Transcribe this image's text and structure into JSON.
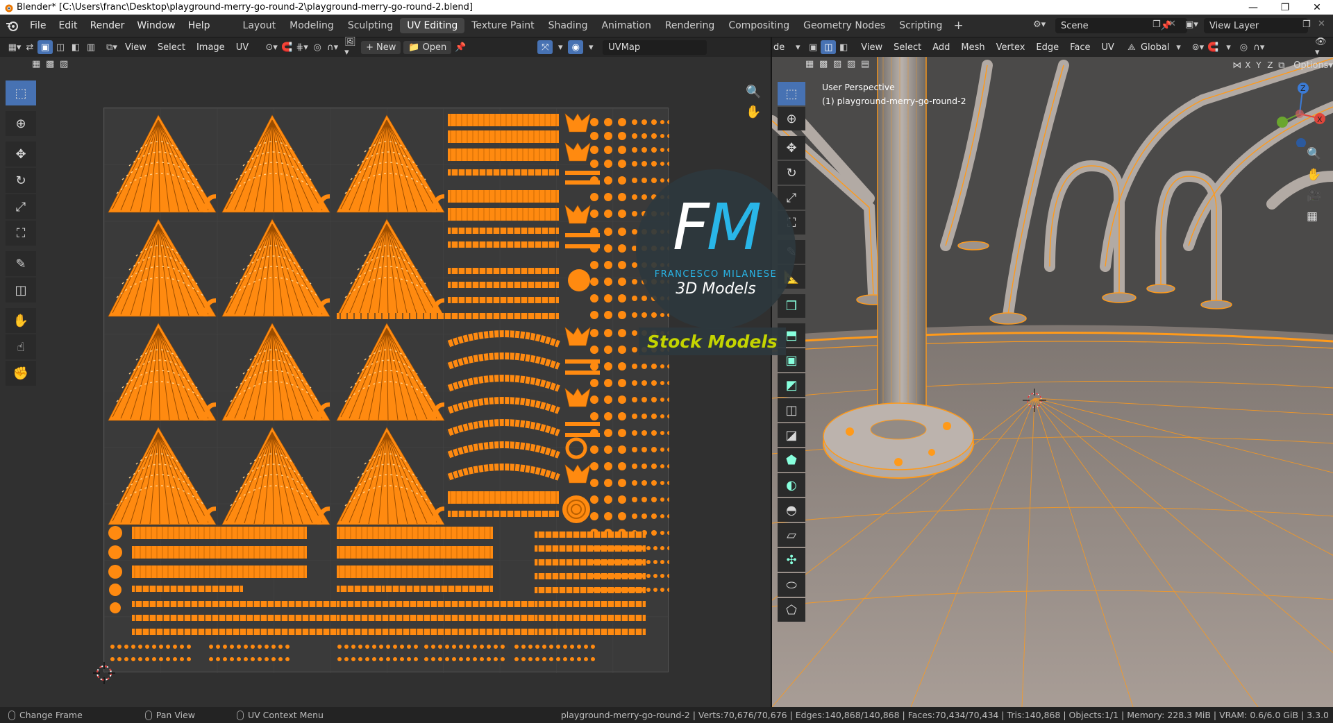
{
  "window": {
    "title": "Blender* [C:\\Users\\franc\\Desktop\\playground-merry-go-round-2\\playground-merry-go-round-2.blend]",
    "buttons": [
      "—",
      "❐",
      "✕"
    ]
  },
  "topbar": {
    "menu": [
      "File",
      "Edit",
      "Render",
      "Window",
      "Help"
    ],
    "workspaces": [
      "Layout",
      "Modeling",
      "Sculpting",
      "UV Editing",
      "Texture Paint",
      "Shading",
      "Animation",
      "Rendering",
      "Compositing",
      "Geometry Nodes",
      "Scripting"
    ],
    "active_workspace": "UV Editing",
    "add_tab": "+",
    "scene": "Scene",
    "view_layer": "View Layer"
  },
  "uv_editor": {
    "menu": [
      "View",
      "Select",
      "Image",
      "UV"
    ],
    "new_label": "New",
    "open_label": "Open",
    "uvmap": "UVMap"
  },
  "viewport": {
    "mode_partial": "de",
    "menu": [
      "View",
      "Select",
      "Add",
      "Mesh",
      "Vertex",
      "Edge",
      "Face",
      "UV"
    ],
    "transform_orientation": "Global",
    "options_label": "Options",
    "axis_x": "X",
    "axis_y": "Y",
    "axis_z": "Z",
    "perspective": "User Perspective",
    "object_name": "(1) playground-merry-go-round-2"
  },
  "watermark": {
    "letter_f": "F",
    "letter_m": "M",
    "name": "FRANCESCO MILANESE",
    "subtitle": "3D Models",
    "banner": "Stock Models"
  },
  "statusbar": {
    "hint1": "Change Frame",
    "hint2": "Pan View",
    "hint3": "UV Context Menu",
    "stats": "playground-merry-go-round-2 | Verts:70,676/70,676 | Edges:140,868/140,868 | Faces:70,434/70,434 | Tris:140,868 | Objects:1/1 | Memory: 228.3 MiB | VRAM: 0.6/6.0 GiB | 3.3.0"
  },
  "colors": {
    "accent": "#4772b3",
    "uv_orange": "#ff8a10",
    "wire_orange": "#ff9a1a"
  }
}
